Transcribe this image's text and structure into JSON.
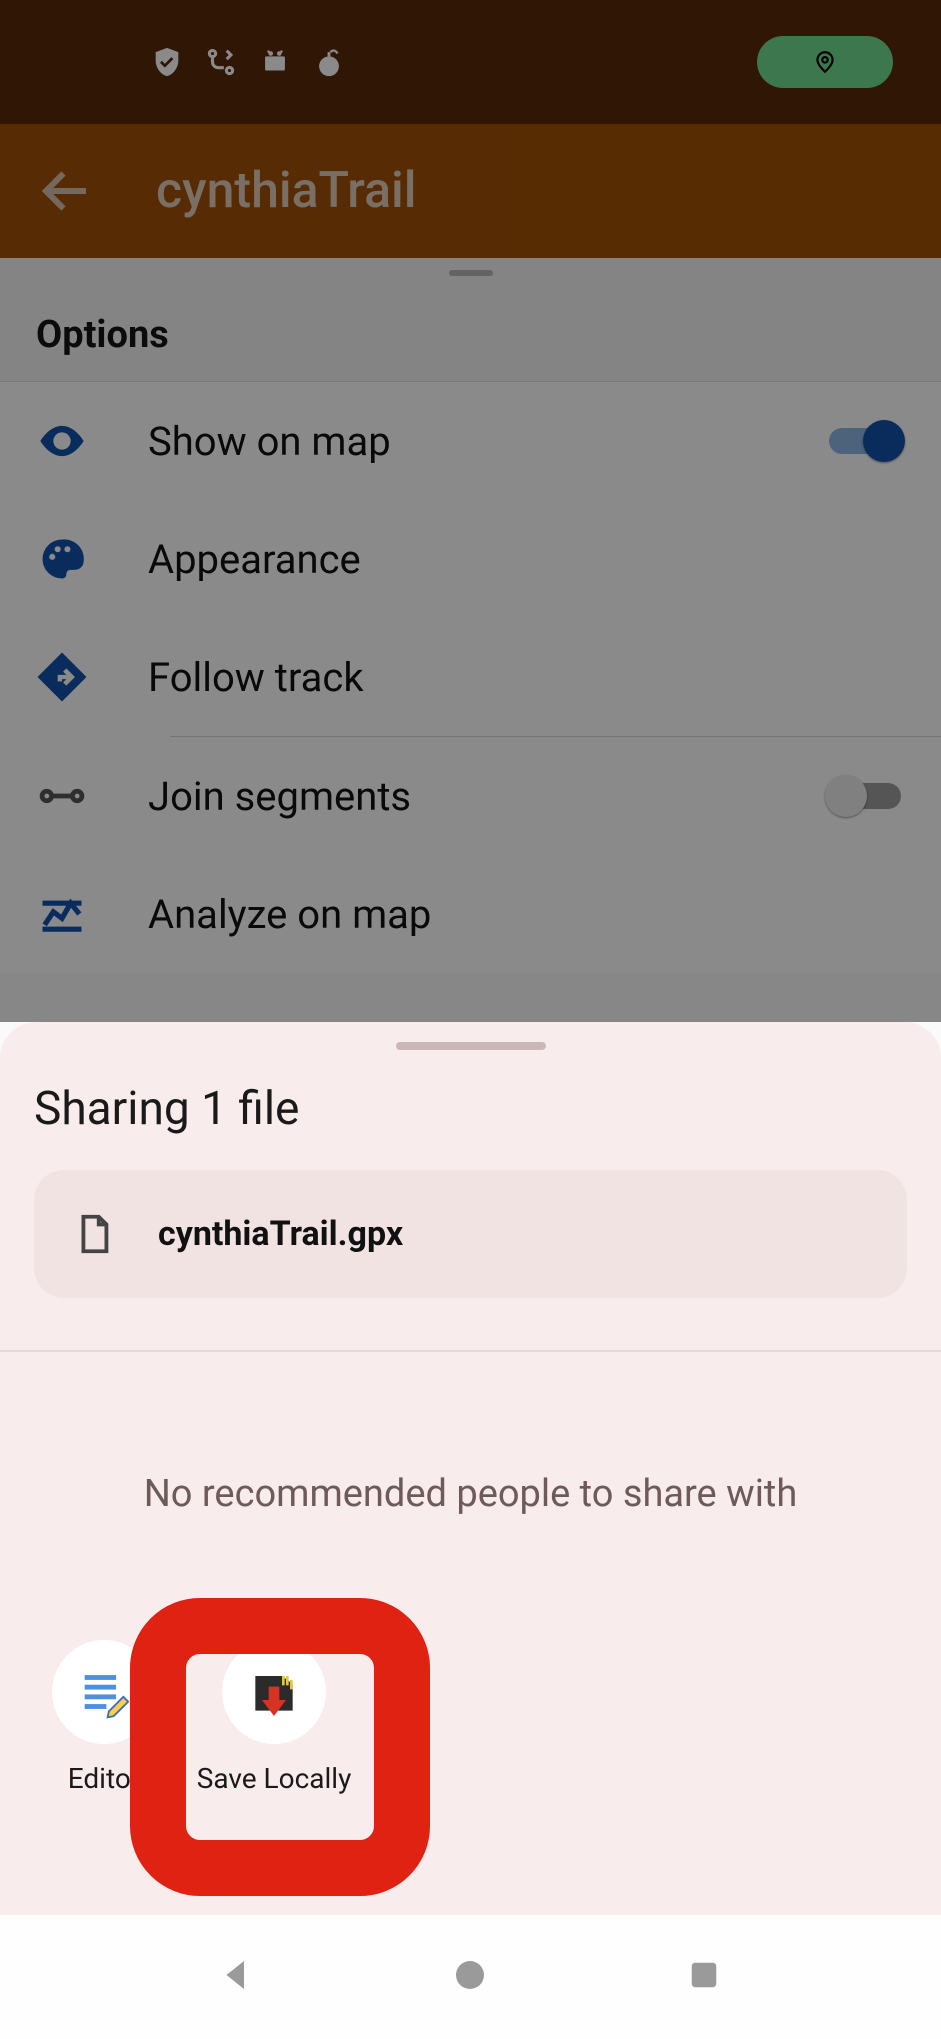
{
  "status": {
    "location_indicator": true
  },
  "header": {
    "title": "cynthiaTrail"
  },
  "options": {
    "section_title": "Options",
    "items": [
      {
        "icon": "eye",
        "label": "Show on map",
        "toggle": true
      },
      {
        "icon": "palette",
        "label": "Appearance",
        "toggle": null
      },
      {
        "icon": "diamond-arrow",
        "label": "Follow track",
        "toggle": null
      },
      {
        "icon": "link-nodes",
        "label": "Join segments",
        "toggle": false
      },
      {
        "icon": "chartline",
        "label": "Analyze on map",
        "toggle": null
      }
    ]
  },
  "share_sheet": {
    "title": "Sharing 1 file",
    "file": {
      "name": "cynthiaTrail.gpx"
    },
    "no_recommendations": "No recommended people to share with",
    "targets": [
      {
        "id": "editor",
        "label": "Editor"
      },
      {
        "id": "save-locally",
        "label": "Save Locally"
      }
    ]
  },
  "highlight": {
    "target": "save-locally",
    "color": "#e02213"
  }
}
